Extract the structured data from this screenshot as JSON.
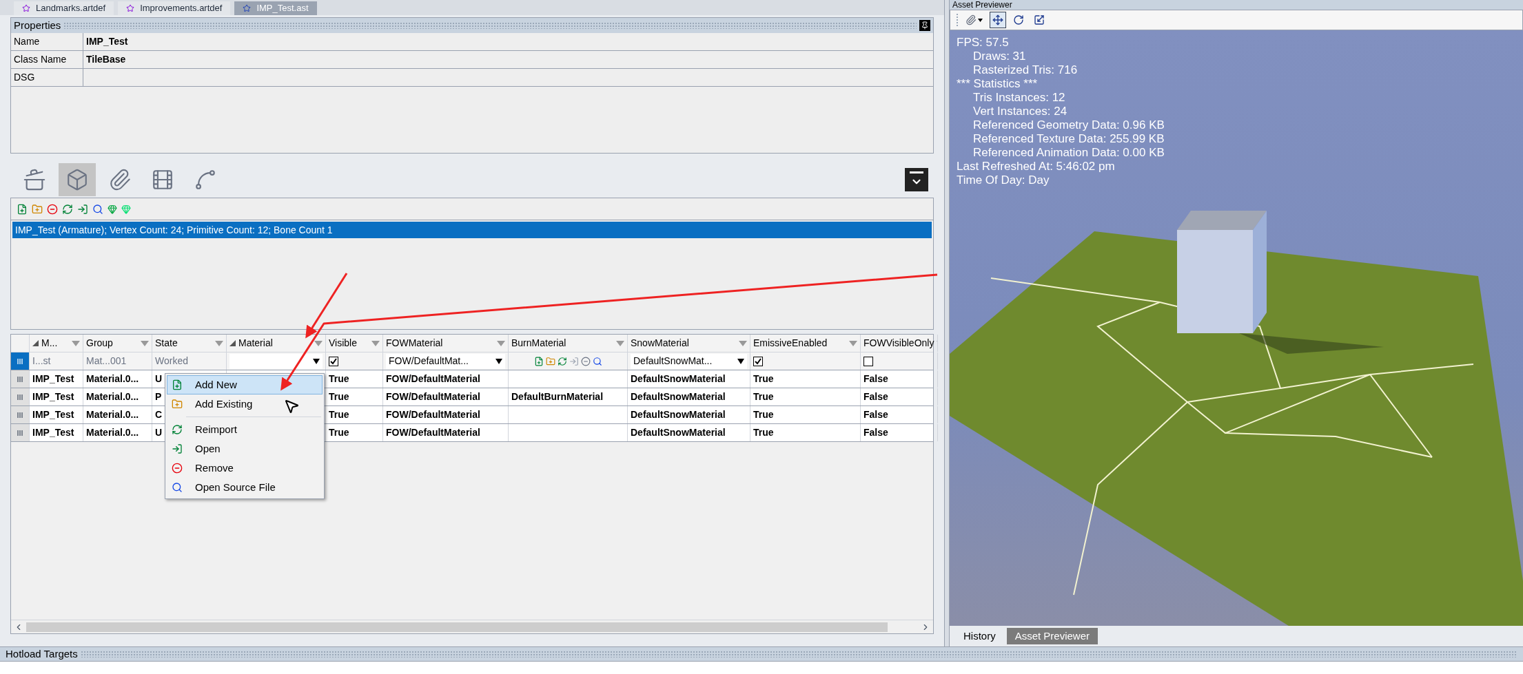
{
  "doc_tabs": [
    {
      "label": "Landmarks.artdef",
      "selected": false
    },
    {
      "label": "Improvements.artdef",
      "selected": false
    },
    {
      "label": "IMP_Test.ast",
      "selected": true
    }
  ],
  "properties": {
    "title": "Properties",
    "rows": [
      {
        "name": "Name",
        "value": "IMP_Test"
      },
      {
        "name": "Class Name",
        "value": "TileBase"
      },
      {
        "name": "DSG"
      }
    ]
  },
  "icon_tabs": [
    {
      "selected": false
    },
    {
      "selected": true
    },
    {
      "selected": false
    },
    {
      "selected": false
    },
    {
      "selected": false
    }
  ],
  "mesh_list": {
    "items": [
      {
        "label": "IMP_Test (Armature); Vertex Count: 24; Primitive Count: 12; Bone Count 1",
        "selected": true
      }
    ]
  },
  "table": {
    "columns": [
      {
        "label": "M...",
        "sorted": true
      },
      {
        "label": "Group",
        "sorted": false
      },
      {
        "label": "State",
        "sorted": false
      },
      {
        "label": "Material",
        "sorted": true
      },
      {
        "label": "Visible",
        "sorted": false
      },
      {
        "label": "FOWMaterial",
        "sorted": false
      },
      {
        "label": "BurnMaterial",
        "sorted": false
      },
      {
        "label": "SnowMaterial",
        "sorted": false
      },
      {
        "label": "EmissiveEnabled",
        "sorted": false
      },
      {
        "label": "FOWVisibleOnly",
        "sorted": false
      }
    ],
    "rows": [
      {
        "kind": "edit",
        "selected": true,
        "cells": [
          {
            "kind": "text",
            "text": "I...st"
          },
          {
            "kind": "text",
            "text": "Mat...001"
          },
          {
            "kind": "text",
            "text": "Worked"
          },
          {
            "kind": "dropdown"
          },
          {
            "kind": "checkbox",
            "checked": true
          },
          {
            "kind": "dropdown",
            "text": "FOW/DefaultMat..."
          },
          {
            "kind": "icons"
          },
          {
            "kind": "dropdown",
            "text": "DefaultSnowMat..."
          },
          {
            "kind": "checkbox",
            "checked": true
          },
          {
            "kind": "checkbox",
            "checked": false
          }
        ]
      },
      {
        "kind": "view",
        "selected": false,
        "cells": [
          {
            "kind": "text",
            "text": "IMP_Test"
          },
          {
            "kind": "text",
            "text": "Material.0..."
          },
          {
            "kind": "text",
            "text": "U"
          },
          {
            "kind": "empty"
          },
          {
            "kind": "text",
            "text": "True"
          },
          {
            "kind": "text",
            "text": "FOW/DefaultMaterial"
          },
          {
            "kind": "empty"
          },
          {
            "kind": "text",
            "text": "DefaultSnowMaterial"
          },
          {
            "kind": "text",
            "text": "True"
          },
          {
            "kind": "text",
            "text": "False"
          }
        ]
      },
      {
        "kind": "view",
        "selected": false,
        "cells": [
          {
            "kind": "text",
            "text": "IMP_Test"
          },
          {
            "kind": "text",
            "text": "Material.0..."
          },
          {
            "kind": "text",
            "text": "P"
          },
          {
            "kind": "empty"
          },
          {
            "kind": "text",
            "text": "True"
          },
          {
            "kind": "text",
            "text": "FOW/DefaultMaterial"
          },
          {
            "kind": "text",
            "text": "DefaultBurnMaterial"
          },
          {
            "kind": "text",
            "text": "DefaultSnowMaterial"
          },
          {
            "kind": "text",
            "text": "True"
          },
          {
            "kind": "text",
            "text": "False"
          }
        ]
      },
      {
        "kind": "view",
        "selected": false,
        "cells": [
          {
            "kind": "text",
            "text": "IMP_Test"
          },
          {
            "kind": "text",
            "text": "Material.0..."
          },
          {
            "kind": "text",
            "text": "C"
          },
          {
            "kind": "empty"
          },
          {
            "kind": "text",
            "text": "True"
          },
          {
            "kind": "text",
            "text": "FOW/DefaultMaterial"
          },
          {
            "kind": "empty"
          },
          {
            "kind": "text",
            "text": "DefaultSnowMaterial"
          },
          {
            "kind": "text",
            "text": "True"
          },
          {
            "kind": "text",
            "text": "False"
          }
        ]
      },
      {
        "kind": "view",
        "selected": false,
        "cells": [
          {
            "kind": "text",
            "text": "IMP_Test"
          },
          {
            "kind": "text",
            "text": "Material.0..."
          },
          {
            "kind": "text",
            "text": "U"
          },
          {
            "kind": "empty"
          },
          {
            "kind": "text",
            "text": "True"
          },
          {
            "kind": "text",
            "text": "FOW/DefaultMaterial"
          },
          {
            "kind": "empty"
          },
          {
            "kind": "text",
            "text": "DefaultSnowMaterial"
          },
          {
            "kind": "text",
            "text": "True"
          },
          {
            "kind": "text",
            "text": "False"
          }
        ]
      }
    ]
  },
  "context_menu": {
    "items": [
      {
        "kind": "item",
        "label": "Add New",
        "selected": true
      },
      {
        "kind": "item",
        "label": "Add Existing",
        "selected": false
      },
      {
        "kind": "separator"
      },
      {
        "kind": "item",
        "label": "Reimport",
        "selected": false
      },
      {
        "kind": "item",
        "label": "Open",
        "selected": false
      },
      {
        "kind": "item",
        "label": "Remove",
        "selected": false
      },
      {
        "kind": "item",
        "label": "Open Source File",
        "selected": false
      }
    ]
  },
  "previewer": {
    "title": "Asset Previewer",
    "tools": [
      {
        "selected": false
      },
      {
        "selected": true
      },
      {
        "selected": false
      },
      {
        "selected": false
      }
    ],
    "stats": [
      {
        "text": "FPS: 57.5",
        "children": [
          {
            "text": "Draws: 31"
          },
          {
            "text": "Rasterized Tris: 716"
          }
        ]
      },
      {
        "text": "*** Statistics ***",
        "children": [
          {
            "text": "Tris Instances: 12"
          },
          {
            "text": "Vert Instances: 24"
          },
          {
            "text": "Referenced Geometry Data: 0.96 KB"
          },
          {
            "text": "Referenced Texture Data: 255.99 KB"
          },
          {
            "text": "Referenced Animation Data: 0.00 KB"
          }
        ]
      },
      {
        "text": "Last Refreshed At: 5:46:02 pm"
      },
      {
        "text": "Time Of Day: Day"
      }
    ]
  },
  "bottom_tabs": [
    {
      "label": "History",
      "selected": false
    },
    {
      "label": "Asset Previewer",
      "selected": true
    }
  ],
  "hotload": {
    "title": "Hotload Targets"
  }
}
